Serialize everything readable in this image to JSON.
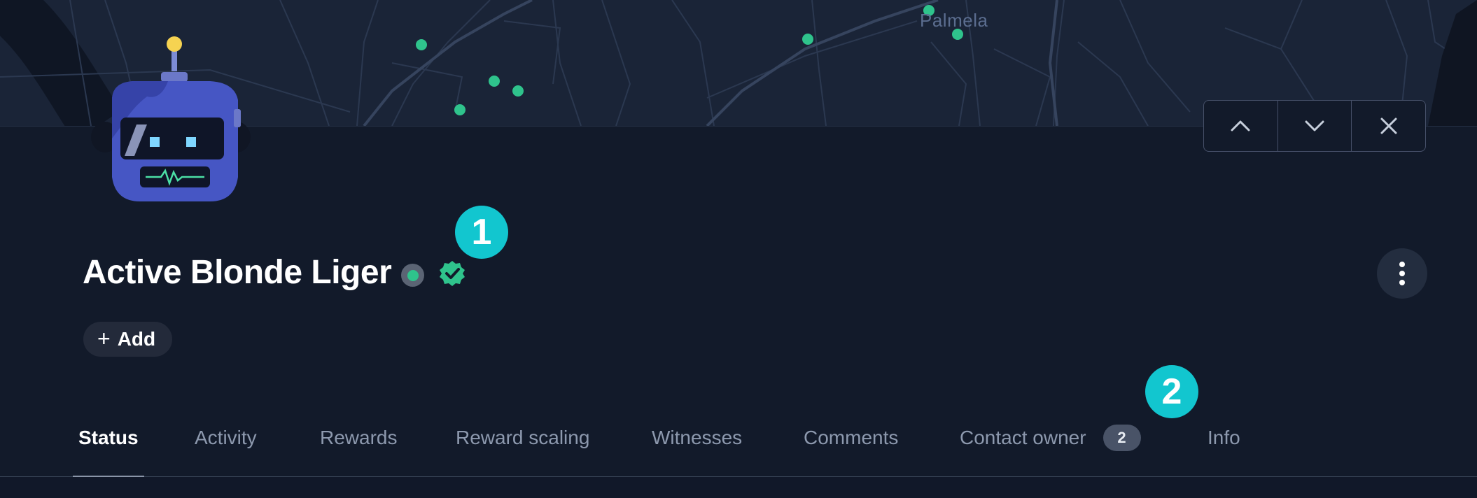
{
  "map": {
    "place_label": "Palmela"
  },
  "header": {
    "title": "Active Blonde Liger",
    "status_color": "#2fc38c",
    "verified_color": "#2fc38c",
    "icons": {
      "status": "status-dot-icon",
      "verified": "verified-badge-icon",
      "prev": "chevron-up-icon",
      "next": "chevron-down-icon",
      "close": "close-icon",
      "more": "more-vertical-icon"
    },
    "add_button": {
      "icon": "+",
      "label": "Add"
    }
  },
  "markers": {
    "first": "1",
    "second": "2"
  },
  "tabs": [
    {
      "label": "Status",
      "active": true
    },
    {
      "label": "Activity"
    },
    {
      "label": "Rewards"
    },
    {
      "label": "Reward scaling"
    },
    {
      "label": "Witnesses"
    },
    {
      "label": "Comments"
    },
    {
      "label": "Contact owner",
      "badge": "2"
    },
    {
      "label": "Info"
    }
  ],
  "colors": {
    "background": "#121a2a",
    "map": "#1a2437",
    "accent": "#12c6cf",
    "dot": "#2fc38c"
  }
}
